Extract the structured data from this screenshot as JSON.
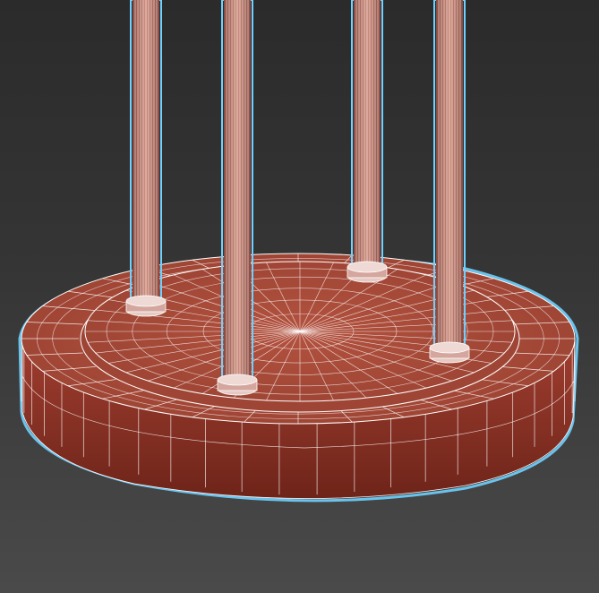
{
  "viewport": {
    "view_label": "",
    "display_mode": "wireframe-over-shaded",
    "background_top": "#2b2b2b",
    "background_bottom": "#4a4a4a"
  },
  "model": {
    "body_color": "#a84a3a",
    "side_color": "#8c3325",
    "wire_color": "#ffffff",
    "selection_outline_color": "#6fd1ff",
    "column_color": "#c27e72"
  }
}
